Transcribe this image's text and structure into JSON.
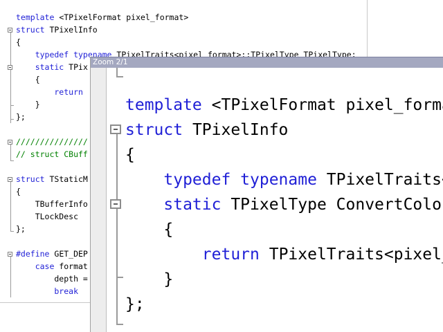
{
  "editor": {
    "lines": [
      {
        "key": "l1",
        "parts": [
          {
            "t": "template ",
            "c": "kw"
          },
          {
            "t": "<TPixelFormat pixel_format>",
            "c": "tx"
          }
        ]
      },
      {
        "key": "l2",
        "parts": [
          {
            "t": "struct ",
            "c": "kw"
          },
          {
            "t": "TPixelInfo",
            "c": "tx"
          }
        ]
      },
      {
        "key": "l3",
        "parts": [
          {
            "t": "{",
            "c": "tx"
          }
        ]
      },
      {
        "key": "l4",
        "parts": [
          {
            "t": "    typedef typename ",
            "c": "kw"
          },
          {
            "t": "TPixelTraits<pixel_format>::TPixelType TPixelType;",
            "c": "tx"
          }
        ]
      },
      {
        "key": "l5",
        "parts": [
          {
            "t": "    static ",
            "c": "kw"
          },
          {
            "t": "TPix",
            "c": "tx"
          }
        ]
      },
      {
        "key": "l6",
        "parts": [
          {
            "t": "    {",
            "c": "tx"
          }
        ]
      },
      {
        "key": "l7",
        "parts": [
          {
            "t": "        return",
            "c": "kw"
          }
        ]
      },
      {
        "key": "l8",
        "parts": [
          {
            "t": "    }",
            "c": "tx"
          }
        ]
      },
      {
        "key": "l9",
        "parts": [
          {
            "t": "};",
            "c": "tx"
          }
        ]
      },
      {
        "key": "l10",
        "parts": [
          {
            "t": "",
            "c": "tx"
          }
        ]
      },
      {
        "key": "l11",
        "parts": [
          {
            "t": "///////////////",
            "c": "cm"
          }
        ]
      },
      {
        "key": "l12",
        "parts": [
          {
            "t": "// struct CBuff",
            "c": "cm"
          }
        ]
      },
      {
        "key": "l13",
        "parts": [
          {
            "t": "",
            "c": "tx"
          }
        ]
      },
      {
        "key": "l14",
        "parts": [
          {
            "t": "struct ",
            "c": "kw"
          },
          {
            "t": "TStaticM",
            "c": "tx"
          }
        ]
      },
      {
        "key": "l15",
        "parts": [
          {
            "t": "{",
            "c": "tx"
          }
        ]
      },
      {
        "key": "l16",
        "parts": [
          {
            "t": "    TBufferInfo",
            "c": "tx"
          }
        ]
      },
      {
        "key": "l17",
        "parts": [
          {
            "t": "    TLockDesc",
            "c": "tx"
          }
        ]
      },
      {
        "key": "l18",
        "parts": [
          {
            "t": "};",
            "c": "tx"
          }
        ]
      },
      {
        "key": "l19",
        "parts": [
          {
            "t": "",
            "c": "tx"
          }
        ]
      },
      {
        "key": "l20",
        "parts": [
          {
            "t": "#define ",
            "c": "kw"
          },
          {
            "t": "GET_DEP",
            "c": "tx"
          }
        ]
      },
      {
        "key": "l21",
        "parts": [
          {
            "t": "    case ",
            "c": "kw"
          },
          {
            "t": "format",
            "c": "tx"
          }
        ]
      },
      {
        "key": "l22",
        "parts": [
          {
            "t": "        depth =",
            "c": "tx"
          }
        ]
      },
      {
        "key": "l23",
        "parts": [
          {
            "t": "        break",
            "c": "kw"
          }
        ]
      }
    ]
  },
  "zoom": {
    "title": "Zoom 2/1",
    "lines": [
      {
        "key": "z1",
        "parts": [
          {
            "t": "",
            "c": "tx"
          }
        ]
      },
      {
        "key": "z2",
        "parts": [
          {
            "t": "template ",
            "c": "kw"
          },
          {
            "t": "<TPixelFormat pixel_format>",
            "c": "tx"
          }
        ]
      },
      {
        "key": "z3",
        "parts": [
          {
            "t": "struct ",
            "c": "kw"
          },
          {
            "t": "TPixelInfo",
            "c": "tx"
          }
        ]
      },
      {
        "key": "z4",
        "parts": [
          {
            "t": "{",
            "c": "tx"
          }
        ]
      },
      {
        "key": "z5",
        "parts": [
          {
            "t": "    typedef typename ",
            "c": "kw"
          },
          {
            "t": "TPixelTraits<pixel_format>",
            "c": "tx"
          }
        ]
      },
      {
        "key": "z6",
        "parts": [
          {
            "t": "    static ",
            "c": "kw"
          },
          {
            "t": "TPixelType ConvertColor",
            "c": "tx"
          }
        ]
      },
      {
        "key": "z7",
        "parts": [
          {
            "t": "    {",
            "c": "tx"
          }
        ]
      },
      {
        "key": "z8",
        "parts": [
          {
            "t": "        return ",
            "c": "kw"
          },
          {
            "t": "TPixelTraits<pixel_format>",
            "c": "tx"
          }
        ]
      },
      {
        "key": "z9",
        "parts": [
          {
            "t": "    }",
            "c": "tx"
          }
        ]
      },
      {
        "key": "z10",
        "parts": [
          {
            "t": "};",
            "c": "tx"
          }
        ]
      }
    ]
  },
  "colors": {
    "keyword": "#1f1fd6",
    "text": "#000000",
    "comment": "#008000",
    "zoom_titlebar": "#a4a8c0"
  },
  "icons": [
    "fold-collapse-icon"
  ]
}
